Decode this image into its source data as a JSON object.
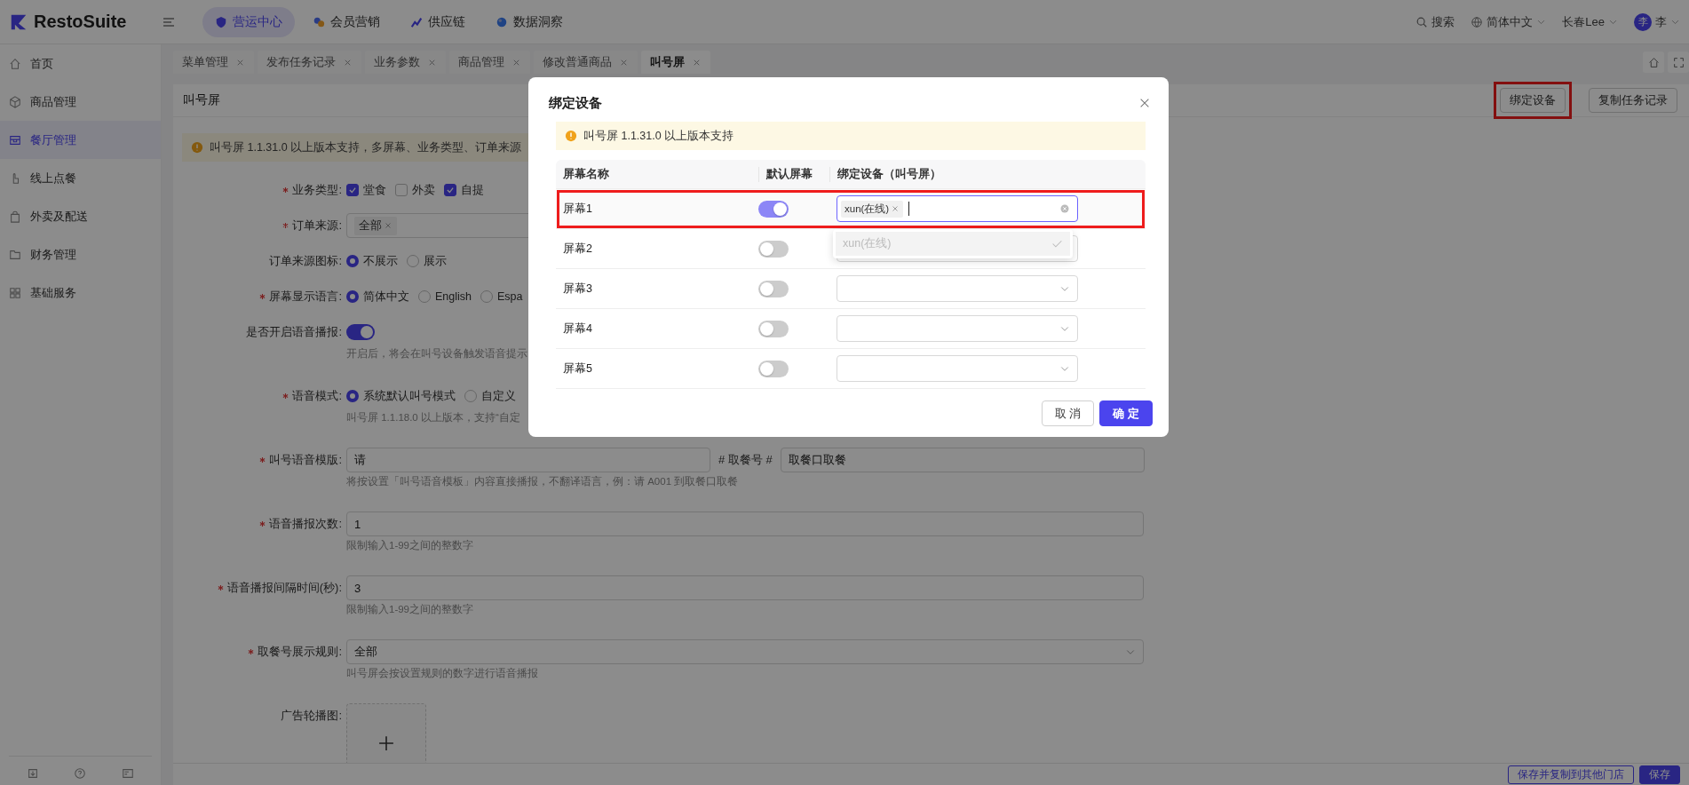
{
  "top_bar": {
    "logo": "RestoSuite",
    "nav": [
      {
        "label": "营运中心",
        "selected": true
      },
      {
        "label": "会员营销",
        "selected": false
      },
      {
        "label": "供应链",
        "selected": false
      },
      {
        "label": "数据洞察",
        "selected": false
      }
    ],
    "search": "搜索",
    "language": "简体中文",
    "store": "长春Lee",
    "avatar": "李",
    "user": "李"
  },
  "sidebar": {
    "items": [
      {
        "label": "首页",
        "selected": false
      },
      {
        "label": "商品管理",
        "selected": false
      },
      {
        "label": "餐厅管理",
        "selected": true
      },
      {
        "label": "线上点餐",
        "selected": false
      },
      {
        "label": "外卖及配送",
        "selected": false
      },
      {
        "label": "财务管理",
        "selected": false
      },
      {
        "label": "基础服务",
        "selected": false
      }
    ]
  },
  "tabs": [
    {
      "label": "菜单管理",
      "selected": false
    },
    {
      "label": "发布任务记录",
      "selected": false
    },
    {
      "label": "业务参数",
      "selected": false
    },
    {
      "label": "商品管理",
      "selected": false
    },
    {
      "label": "修改普通商品",
      "selected": false
    },
    {
      "label": "叫号屏",
      "selected": true
    }
  ],
  "page": {
    "title": "叫号屏",
    "actions": [
      {
        "label": "绑定设备",
        "highlighted": true
      },
      {
        "label": "复制任务记录",
        "highlighted": false
      }
    ]
  },
  "form": {
    "alert": "叫号屏 1.1.31.0 以上版本支持，多屏幕、业务类型、订单来源",
    "fields": [
      {
        "kind": "checkboxes",
        "label": "业务类型:",
        "required": true,
        "options": [
          {
            "label": "堂食",
            "checked": true
          },
          {
            "label": "外卖",
            "checked": false
          },
          {
            "label": "自提",
            "checked": true
          }
        ]
      },
      {
        "kind": "tags",
        "label": "订单来源:",
        "required": true,
        "tags": [
          "全部"
        ]
      },
      {
        "kind": "radios",
        "label": "订单来源图标:",
        "required": false,
        "options": [
          {
            "label": "不展示",
            "selected": true
          },
          {
            "label": "展示",
            "selected": false
          }
        ]
      },
      {
        "kind": "radios",
        "label": "屏幕显示语言:",
        "required": true,
        "options": [
          {
            "label": "简体中文",
            "selected": true
          },
          {
            "label": "English",
            "selected": false
          },
          {
            "label": "Espa",
            "selected": false
          }
        ]
      },
      {
        "kind": "switch",
        "label": "是否开启语音播报:",
        "required": false,
        "on": true,
        "hint": "开启后，将会在叫号设备触发语音提示"
      },
      {
        "kind": "radios",
        "label": "语音模式:",
        "required": true,
        "options": [
          {
            "label": "系统默认叫号模式",
            "selected": true
          },
          {
            "label": "自定义",
            "selected": false
          }
        ],
        "hint": "叫号屏 1.1.18.0 以上版本，支持“自定"
      },
      {
        "kind": "template",
        "label": "叫号语音模版:",
        "required": true,
        "value": "请",
        "middle": "# 取餐号 #",
        "value_2": "取餐口取餐",
        "hint": "将按设置「叫号语音模板」内容直接播报，不翻译语言，例：请 A001 到取餐口取餐"
      },
      {
        "kind": "input",
        "label": "语音播报次数:",
        "required": true,
        "value": "1",
        "hint": "限制输入1-99之间的整数字"
      },
      {
        "kind": "input",
        "label": "语音播报间隔时间(秒):",
        "required": true,
        "value": "3",
        "hint": "限制输入1-99之间的整数字"
      },
      {
        "kind": "select",
        "label": "取餐号展示规则:",
        "required": true,
        "value": "全部",
        "hint": "叫号屏会按设置规则的数字进行语音播报"
      },
      {
        "kind": "upload",
        "label": "广告轮播图:",
        "required": false
      }
    ]
  },
  "footer": {
    "buttons": [
      {
        "label": "保存并复制到其他门店",
        "primary": false
      },
      {
        "label": "保存",
        "primary": true
      }
    ]
  },
  "dialog": {
    "title": "绑定设备",
    "alert": "叫号屏 1.1.31.0 以上版本支持",
    "columns": [
      "屏幕名称",
      "默认屏幕",
      "绑定设备（叫号屏）"
    ],
    "rows": [
      {
        "name": "屏幕1",
        "default": true,
        "devices": [
          "xun(在线)"
        ],
        "focused": true,
        "highlighted": true
      },
      {
        "name": "屏幕2",
        "default": false,
        "devices": [],
        "focused": false,
        "highlighted": false
      },
      {
        "name": "屏幕3",
        "default": false,
        "devices": [],
        "focused": false,
        "highlighted": false
      },
      {
        "name": "屏幕4",
        "default": false,
        "devices": [],
        "focused": false,
        "highlighted": false
      },
      {
        "name": "屏幕5",
        "default": false,
        "devices": [],
        "focused": false,
        "highlighted": false
      }
    ],
    "dropdown": {
      "options": [
        {
          "label": "xun(在线)",
          "selected": true
        }
      ]
    },
    "buttons": [
      {
        "label": "取 消",
        "primary": false
      },
      {
        "label": "确 定",
        "primary": true
      }
    ]
  }
}
